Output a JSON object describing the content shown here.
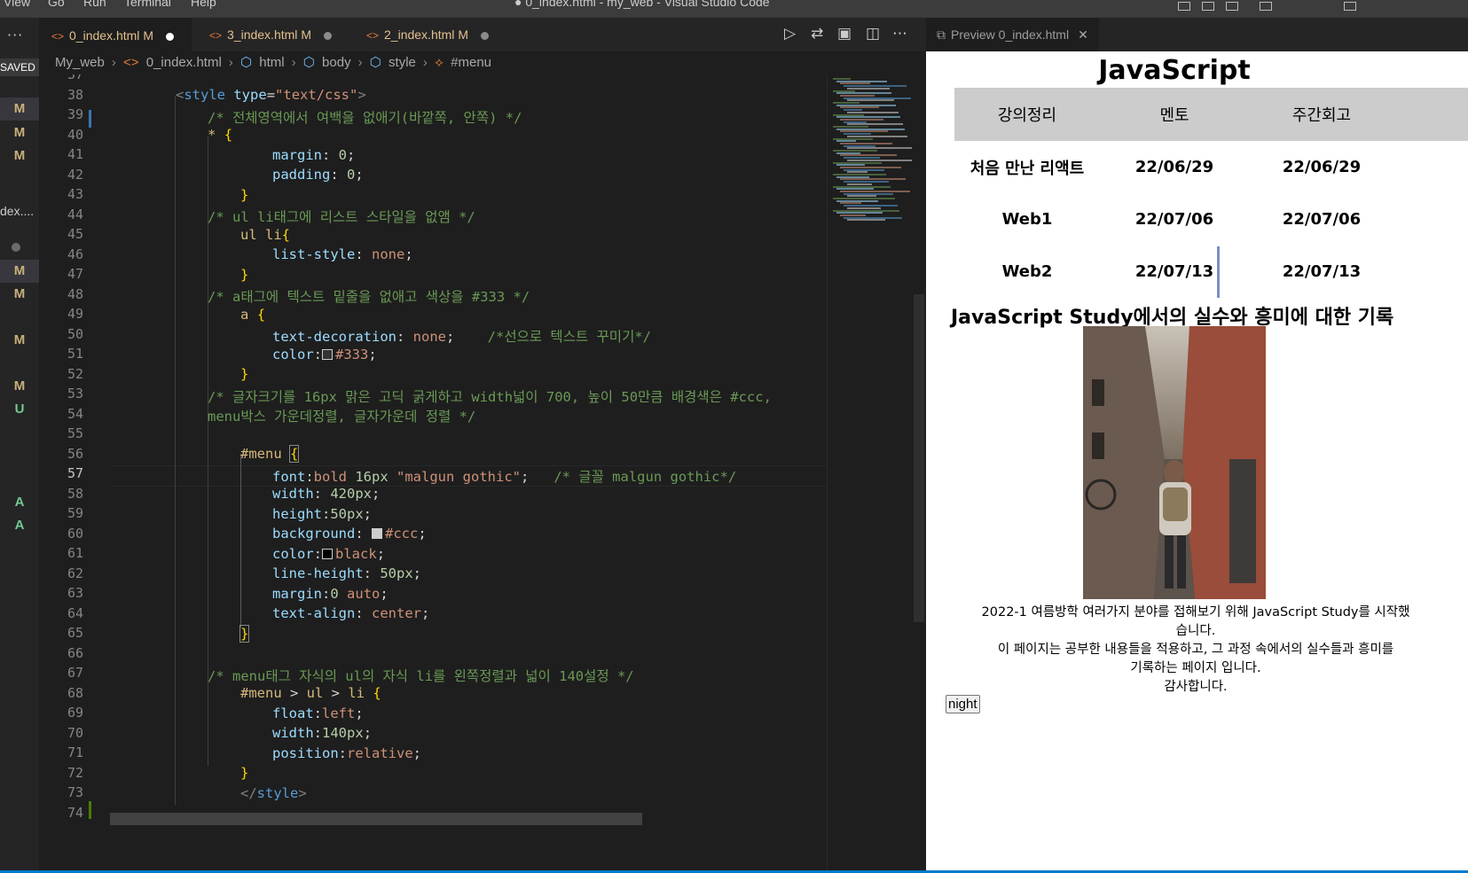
{
  "menubar": {
    "items": [
      "View",
      "Go",
      "Run",
      "Terminal",
      "Help"
    ],
    "window_title": "● 0_index.html - my_web - Visual Studio Code"
  },
  "activity": {
    "more_label": "···",
    "saved_label": "SAVED",
    "index_label": "dex....",
    "git_markers": [
      "M",
      "M",
      "M",
      "M",
      "M",
      "M",
      "M",
      "U",
      "A",
      "A"
    ]
  },
  "tabs": [
    {
      "label": "0_index.html",
      "status": "M",
      "active": true
    },
    {
      "label": "3_index.html",
      "status": "M",
      "active": false
    },
    {
      "label": "2_index.html",
      "status": "M",
      "active": false
    }
  ],
  "breadcrumb": [
    "My_web",
    "0_index.html",
    "html",
    "body",
    "style",
    "#menu"
  ],
  "preview_tab": {
    "label": "Preview 0_index.html"
  },
  "editor": {
    "current_line": 57,
    "line_numbers": [
      37,
      38,
      39,
      40,
      41,
      42,
      43,
      44,
      45,
      46,
      47,
      48,
      49,
      50,
      51,
      52,
      53,
      54,
      55,
      56,
      57,
      58,
      59,
      60,
      61,
      62,
      63,
      64,
      65,
      66,
      67,
      68,
      69,
      70,
      71,
      72,
      73,
      74
    ]
  },
  "code": {
    "l38_open": "<",
    "l38_tag": "style",
    "l38_attr": " type",
    "l38_eq": "=",
    "l38_val": "\"text/css\"",
    "l38_close": ">",
    "l39": "/* 전체영역에서 여백을 없애기(바깥쪽, 안쪽) */",
    "l40_sel": "*",
    "l40_br": "{",
    "l41_p": "margin",
    "l41_v": "0",
    "l42_p": "padding",
    "l42_v": "0",
    "l43": "}",
    "l44": "/* ul li태그에 리스트 스타일을 없앰 */",
    "l45_sel": "ul li",
    "l45_br": "{",
    "l46_p": "list-style",
    "l46_v": "none",
    "l47": "}",
    "l48": "/* a태그에 텍스트 밑줄을 없애고 색상을 #333 */",
    "l49_sel": "a",
    "l49_br": "{",
    "l50_p": "text-decoration",
    "l50_v": "none",
    "l50_c": "/*선으로 텍스트 꾸미기*/",
    "l51_p": "color",
    "l51_v": "#333",
    "l52": "}",
    "l53": "/* 글자크기를 16px 맑은 고딕 굵게하고 width넓이 700, 높이 50만큼 배경색은 #ccc,",
    "l54": "menu박스 가운데정렬, 글자가운데 정렬 */",
    "l56_sel": "#menu",
    "l56_br": "{",
    "l57_p": "font",
    "l57_v1": "bold",
    "l57_n": "16px",
    "l57_s": "\"malgun gothic\"",
    "l57_c": "/* 글꼴 malgun gothic*/",
    "l58_p": "width",
    "l58_n": "420px",
    "l59_p": "height",
    "l59_n": "50px",
    "l60_p": "background",
    "l60_v": "#ccc",
    "l61_p": "color",
    "l61_v": "black",
    "l62_p": "line-height",
    "l62_n": "50px",
    "l63_p": "margin",
    "l63_n": "0",
    "l63_v": "auto",
    "l64_p": "text-align",
    "l64_v": "center",
    "l65": "}",
    "l67": "/* menu태그 자식의 ul의 자식 li를 왼쪽정렬과 넓이 140설정 */",
    "l68_sel": "#menu",
    "l68_rest": "ul",
    "l68_li": "li",
    "l68_br": "{",
    "l69_p": "float",
    "l69_v": "left",
    "l70_p": "width",
    "l70_n": "140px",
    "l71_p": "position",
    "l71_v": "relative",
    "l72": "}",
    "l73_tag": "style"
  },
  "colors": {
    "swatch_333": "#333333",
    "swatch_ccc": "#cccccc",
    "swatch_black": "#000000"
  },
  "preview": {
    "title": "JavaScript",
    "menu_headers": [
      "강의정리",
      "멘토",
      "주간회고"
    ],
    "rows": [
      [
        "처음 만난 리액트",
        "22/06/29",
        "22/06/29"
      ],
      [
        "Web1",
        "22/07/06",
        "22/07/06"
      ],
      [
        "Web2",
        "22/07/13",
        "22/07/13"
      ]
    ],
    "subtitle": "JavaScript Study에서의 실수와 흥미에 대한 기록",
    "photo_alt": "woman with backpack in narrow alley",
    "paragraph": [
      "2022-1 여름방학 여러가지 분야를 접해보기 위해 JavaScript Study를 시작했",
      "습니다.",
      "이 페이지는 공부한 내용들을 적용하고, 그 과정 속에서의 실수들과 흥미를",
      "기록하는 페이지 입니다.",
      "감사합니다."
    ],
    "button_label": "night"
  }
}
